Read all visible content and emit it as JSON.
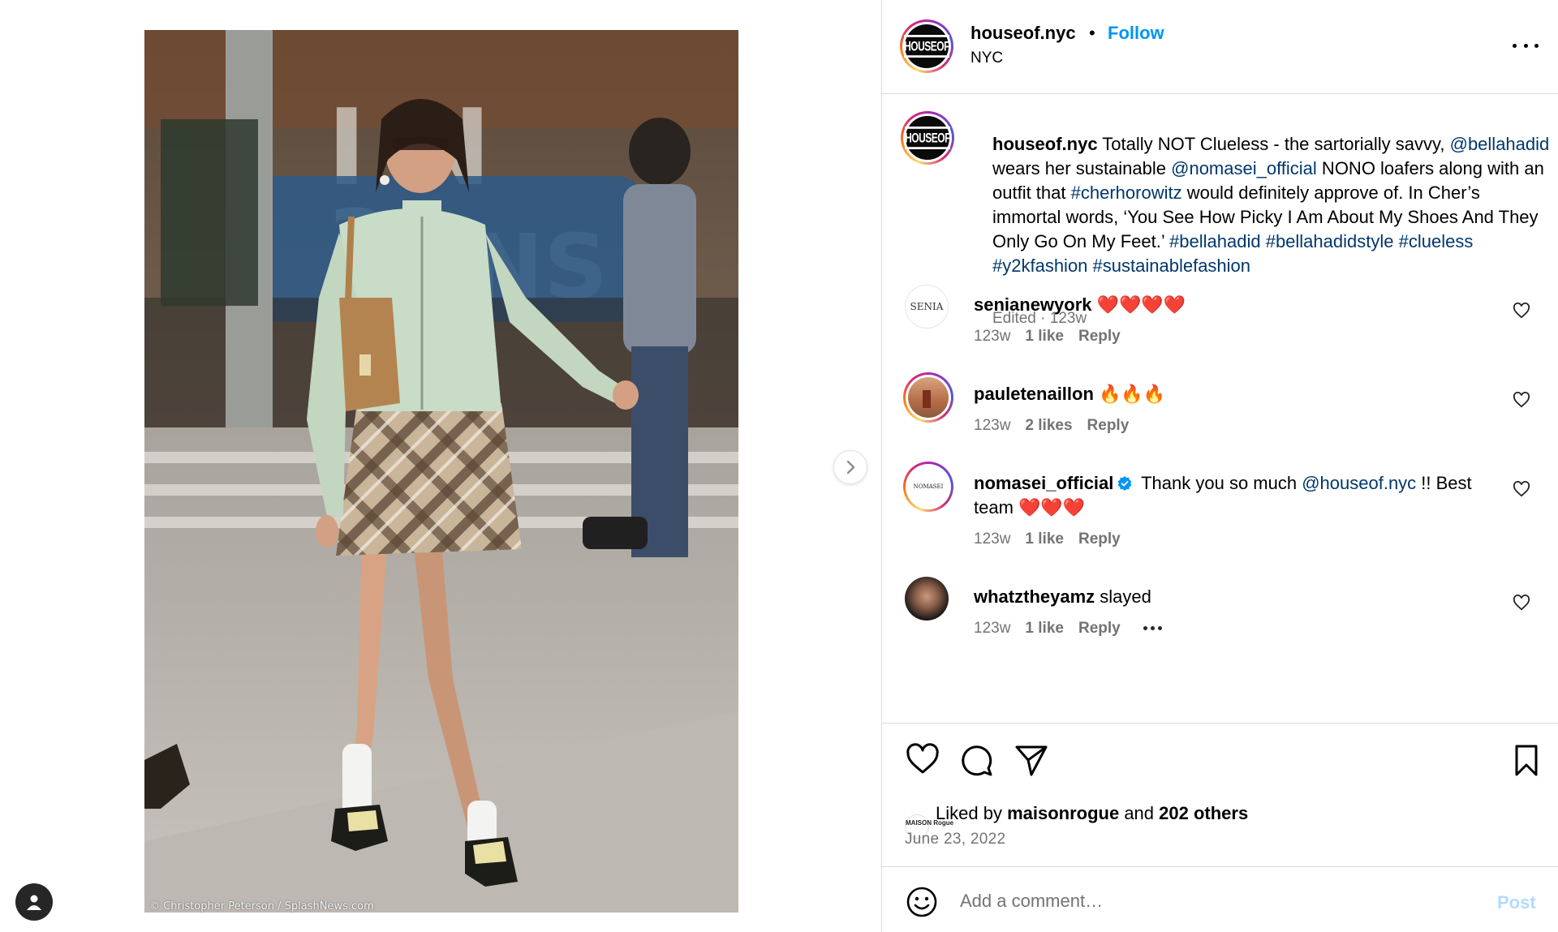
{
  "media": {
    "photo_credit": "© Christopher Peterson / SplashNews.com",
    "next_icon": "chevron-right-icon",
    "profile_icon": "user-icon"
  },
  "header": {
    "username": "houseof.nyc",
    "separator": "•",
    "follow_label": "Follow",
    "location": "NYC",
    "avatar_text": "HOUSEOF",
    "more_icon": "more-horizontal-icon"
  },
  "caption": {
    "username": "houseof.nyc",
    "parts": [
      {
        "text": " Totally NOT Clueless - the sartorially savvy, ",
        "kind": "text"
      },
      {
        "text": "@bellahadid",
        "kind": "mention"
      },
      {
        "text": " wears her sustainable ",
        "kind": "text"
      },
      {
        "text": "@nomasei_official",
        "kind": "mention"
      },
      {
        "text": " NONO loafers along with an outfit that ",
        "kind": "text"
      },
      {
        "text": "#cherhorowitz",
        "kind": "tag"
      },
      {
        "text": " would definitely approve of. In Cher’s immortal words, ‘You See How Picky I Am About My Shoes And They Only Go On My Feet.’ ",
        "kind": "text"
      },
      {
        "text": "#bellahadid",
        "kind": "tag"
      },
      {
        "text": " ",
        "kind": "text"
      },
      {
        "text": "#bellahadidstyle",
        "kind": "tag"
      },
      {
        "text": " ",
        "kind": "text"
      },
      {
        "text": "#clueless",
        "kind": "tag"
      },
      {
        "text": " ",
        "kind": "text"
      },
      {
        "text": "#y2kfashion",
        "kind": "tag"
      },
      {
        "text": " ",
        "kind": "text"
      },
      {
        "text": "#sustainablefashion",
        "kind": "tag"
      }
    ],
    "meta": "Edited · 123w"
  },
  "comments": [
    {
      "username": "senianewyork",
      "text": " ❤️❤️❤️❤️",
      "time": "123w",
      "likes": "1 like",
      "reply": "Reply",
      "avatar_text": "SENIA",
      "verified": false
    },
    {
      "username": "pauletenaillon",
      "text": " 🔥🔥🔥",
      "time": "123w",
      "likes": "2 likes",
      "reply": "Reply",
      "avatar_text": "",
      "verified": false
    },
    {
      "username": "nomasei_official",
      "text_before_mention": " Thank you so much ",
      "mention": "@houseof.nyc",
      "text_after_mention": " !! Best team ❤️❤️❤️",
      "time": "123w",
      "likes": "1 like",
      "reply": "Reply",
      "avatar_text": "NOMASEI",
      "verified": true
    },
    {
      "username": "whatztheyamz",
      "text": " slayed",
      "time": "123w",
      "likes": "1 like",
      "reply": "Reply",
      "avatar_text": "",
      "verified": false
    }
  ],
  "actions": {
    "like_icon": "heart-icon",
    "comment_icon": "comment-icon",
    "share_icon": "send-icon",
    "save_icon": "bookmark-icon",
    "liked_by_prefix": "Liked by ",
    "liked_by_user": "maisonrogue",
    "liked_by_middle": " and ",
    "liked_by_others": "202 others",
    "liked_avatar_text": "MAISON Rogue",
    "date": "June 23, 2022"
  },
  "comment_box": {
    "emoji_icon": "emoji-icon",
    "placeholder": "Add a comment…",
    "post_label": "Post"
  },
  "colors": {
    "link_blue": "#0095f6",
    "mention_blue": "#00376b",
    "muted_text": "#737373",
    "post_disabled": "#b3dbff",
    "divider": "#dbdbdb"
  }
}
